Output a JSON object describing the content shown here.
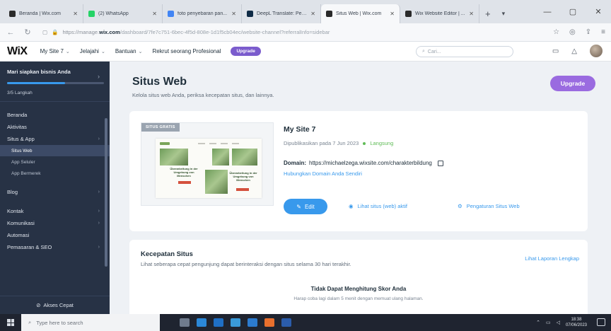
{
  "browser": {
    "tabs": [
      {
        "title": "Beranda | Wix.com",
        "color": "#2a2a2a"
      },
      {
        "title": "(2) WhatsApp",
        "color": "#25d366"
      },
      {
        "title": "foto penyebaran pan...",
        "color": "#4285f4"
      },
      {
        "title": "DeepL Translate: Pen...",
        "color": "#0f2b46"
      },
      {
        "title": "Situs Web | Wix.com",
        "color": "#2a2a2a"
      },
      {
        "title": "Wix Website Editor | ...",
        "color": "#2a2a2a"
      }
    ],
    "new_tab": "+",
    "url_prefix": "https://manage.",
    "url_host": "wix.com",
    "url_path": "/dashboard/7fe7c751-6bec-4f5d-808e-1d1f5cb04ec/website-channel?referralInfo=sidebar"
  },
  "wix_bar": {
    "logo": "WiX",
    "site_selector": "My Site 7",
    "explore": "Jelajahi",
    "help": "Bantuan",
    "hire": "Rekrut seorang Profesional",
    "upgrade_pill": "Upgrade",
    "search_placeholder": "Cari..."
  },
  "sidebar": {
    "promo_title": "Mari siapkan bisnis Anda",
    "progress": 0.6,
    "steps": "3/5 Langkah",
    "items": [
      {
        "label": "Beranda",
        "arrow": false,
        "sub": false
      },
      {
        "label": "Aktivitas",
        "arrow": false,
        "sub": false
      },
      {
        "label": "Situs & App",
        "arrow": true,
        "sub": false
      },
      {
        "label": "Situs Web",
        "arrow": false,
        "sub": true,
        "active": true
      },
      {
        "label": "App Seluler",
        "arrow": false,
        "sub": true
      },
      {
        "label": "App Bermerek",
        "arrow": false,
        "sub": true
      }
    ],
    "items2": [
      {
        "label": "Blog",
        "arrow": true
      }
    ],
    "items3": [
      {
        "label": "Kontak",
        "arrow": true
      },
      {
        "label": "Komunikasi",
        "arrow": true
      },
      {
        "label": "Automasi",
        "arrow": false
      },
      {
        "label": "Pemasaran & SEO",
        "arrow": true
      }
    ],
    "quick_access": "Akses Cepat"
  },
  "main": {
    "title": "Situs Web",
    "subtitle": "Kelola situs web Anda, periksa kecepatan situs, dan lainnya.",
    "upgrade_label": "Upgrade",
    "site_card": {
      "badge": "SITUS GRATIS",
      "thumb_text_left": "Überarbeitung in der Umgebung von Menschen",
      "thumb_text_right": "Überarbeitung in der Umgebung von Menschen",
      "site_name": "My Site 7",
      "published": "Dipublikasikan pada 7 Jun 2023",
      "status": "Langsung",
      "domain_label": "Domain:",
      "domain_url": "https://michaelzega.wixsite.com/charakterbildung",
      "connect_domain": "Hubungkan Domain Anda Sendiri",
      "edit_label": "Edit",
      "view_live": "Lihat situs (web) aktif",
      "settings": "Pengaturan Situs Web"
    },
    "speed_card": {
      "title": "Kecepatan Situs",
      "subtitle": "Lihat seberapa cepat pengunjung dapat berinteraksi dengan situs selama 30 hari terakhir.",
      "full_report": "Lihat Laporan Lengkap",
      "score_title": "Tidak Dapat Menghitung Skor Anda",
      "score_sub": "Harap coba lagi dalam 5 menit dengan memuat ulang halaman."
    }
  },
  "taskbar": {
    "search_placeholder": "Type here to search",
    "time": "18:38",
    "date": "07/06/2023"
  },
  "colors": {
    "accent_blue": "#3899ec",
    "upgrade_purple": "#9a6be0",
    "live_green": "#60bc57",
    "sidebar_bg": "#273245"
  }
}
